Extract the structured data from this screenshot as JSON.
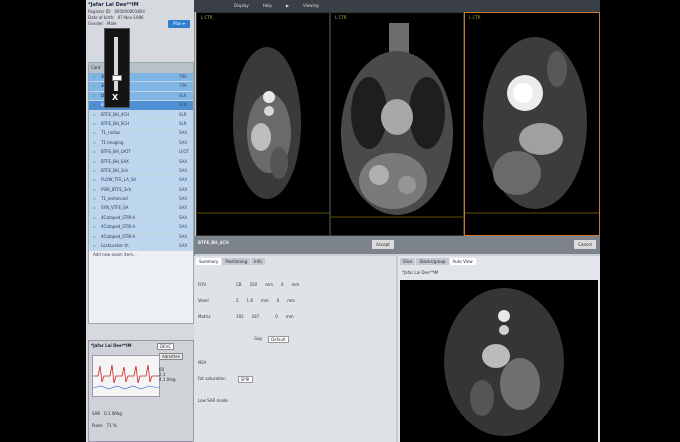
{
  "patient": {
    "name": "*Jafar Lai Dee**IM",
    "rows": [
      [
        "Register ID:",
        "000000001804"
      ],
      [
        "Date of birth:",
        "07-Nov-1986"
      ],
      [
        "Gender:",
        "Male"
      ]
    ],
    "plan_label": "Plan ▾"
  },
  "slider": {
    "close_glyph": "X"
  },
  "list": {
    "header": [
      "Card",
      "Name",
      "Ct"
    ],
    "items": [
      {
        "label": "3P_PS_Pilot",
        "count": "TRA",
        "state": "done"
      },
      {
        "label": "3P_PS_Pilot",
        "count": "TRA",
        "state": "done"
      },
      {
        "label": "DE_PS_2ch",
        "count": "SLR",
        "state": "done"
      },
      {
        "label": "BTFE_BH_4CH",
        "count": "SLR",
        "state": "sel"
      },
      {
        "label": "BTFE_BH_4CH",
        "count": "SLR",
        "state": "todo"
      },
      {
        "label": "BTFE_BH_SCH",
        "count": "SLR",
        "state": "todo"
      },
      {
        "label": "T1_radius",
        "count": "SAX",
        "state": "todo"
      },
      {
        "label": "T1 Imaging",
        "count": "SAX",
        "state": "todo"
      },
      {
        "label": "BTFE_BH_LVOT",
        "count": "LVOT",
        "state": "todo"
      },
      {
        "label": "BTFE_BH_SAX",
        "count": "SAX",
        "state": "todo"
      },
      {
        "label": "BTFE_BH_3ch",
        "count": "SAX",
        "state": "todo"
      },
      {
        "label": "FLOW_TFE_LA_SA",
        "count": "SAX",
        "state": "todo"
      },
      {
        "label": "PSIR_BTFE_3ch",
        "count": "SAX",
        "state": "todo"
      },
      {
        "label": "T1_enhanced",
        "count": "SAX",
        "state": "todo"
      },
      {
        "label": "SYN_VTFE_SA",
        "count": "SAX",
        "state": "todo"
      },
      {
        "label": "4Cataped_STIR-A",
        "count": "SAX",
        "state": "todo"
      },
      {
        "label": "4Cataped_STIR-A",
        "count": "SAX",
        "state": "todo"
      },
      {
        "label": "4Cataped_STIR-A",
        "count": "SAX",
        "state": "todo"
      },
      {
        "label": "LockLocker th",
        "count": "SAX",
        "state": "todo"
      }
    ],
    "add_new": "Add new exam item..."
  },
  "lower_panel": {
    "name": "*Jafar Lai Dee**IM",
    "select": "DEVC",
    "button": "Admitten",
    "values": [
      "60",
      "2.1",
      "4.1 l/mg"
    ],
    "sar": "SAR",
    "sar_value": "0.1 W/kg",
    "pulse_label": "Pulse",
    "pulse_value": "71 %"
  },
  "topbar": {
    "items": [
      "Display",
      "Help",
      "Viewing"
    ]
  },
  "viewports": [
    {
      "label": "L  CTR"
    },
    {
      "label": "L  CTR"
    },
    {
      "label": "L  CTR"
    }
  ],
  "tools": {
    "sequence": "BTFE_BH_4CH",
    "accept": "Accept",
    "cancel": "Cancel"
  },
  "params": {
    "tabs": [
      "Summary",
      "Positioning",
      "Info"
    ],
    "rows": [
      {
        "label": "FOV",
        "v1": "CB",
        "v2": "350",
        "v3": "mm",
        "v4": "0",
        "unit": "mm"
      },
      {
        "label": "Voxel",
        "v1": "2",
        "v2": "1.8",
        "v3": "mm",
        "v4": "0",
        "unit": "mm"
      },
      {
        "label": "Matrix",
        "v1": "192",
        "v2": "187",
        "v3": "",
        "v4": "0",
        "unit": "mm"
      }
    ],
    "gap_label": "Gap",
    "gap_option": "Default",
    "nsa_label": "NSA",
    "fat_label": "Fat saturation",
    "fat_value": "SPIR",
    "low_label": "Low SAR mode"
  },
  "preview": {
    "tabs": [
      "Slice",
      "Stacks/group",
      "Auto View"
    ],
    "caption": "*Jafar Lai Dee**IM"
  }
}
